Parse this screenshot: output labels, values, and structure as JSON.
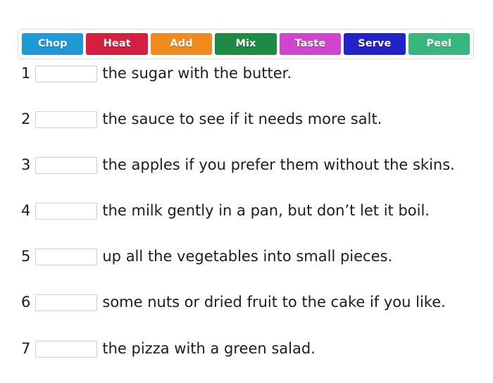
{
  "wordbank": {
    "name": "word-bank",
    "chips": [
      {
        "label": "Chop",
        "color": "#1e9bd7"
      },
      {
        "label": "Heat",
        "color": "#d41f41"
      },
      {
        "label": "Add",
        "color": "#f08a1c"
      },
      {
        "label": "Mix",
        "color": "#1d8a45"
      },
      {
        "label": "Taste",
        "color": "#d044d0"
      },
      {
        "label": "Serve",
        "color": "#2222c8"
      },
      {
        "label": "Peel",
        "color": "#37b77c"
      }
    ]
  },
  "exercise": {
    "items": [
      {
        "number": "1",
        "value": "",
        "placeholder": "",
        "text": "the sugar with the butter."
      },
      {
        "number": "2",
        "value": "",
        "placeholder": "",
        "text": "the sauce to see if it needs more salt."
      },
      {
        "number": "3",
        "value": "",
        "placeholder": "",
        "text": "the apples if you prefer them without the skins."
      },
      {
        "number": "4",
        "value": "",
        "placeholder": "",
        "text": "the milk gently in a pan, but don’t let it boil."
      },
      {
        "number": "5",
        "value": "",
        "placeholder": "",
        "text": "up all the vegetables into small pieces."
      },
      {
        "number": "6",
        "value": "",
        "placeholder": "",
        "text": "some nuts or dried fruit to the cake if you like."
      },
      {
        "number": "7",
        "value": "",
        "placeholder": "",
        "text": "the pizza with a green salad."
      }
    ]
  }
}
